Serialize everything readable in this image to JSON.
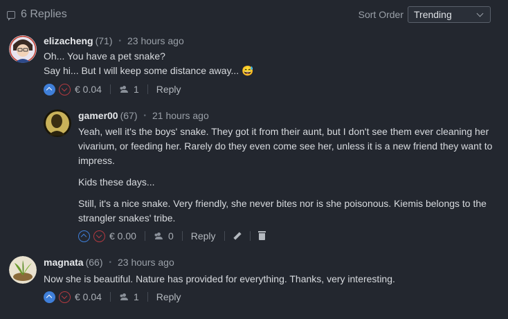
{
  "header": {
    "replies_label": "6 Replies",
    "sort_label": "Sort Order",
    "sort_value": "Trending"
  },
  "comments": [
    {
      "author": "elizacheng",
      "reputation": "(71)",
      "time": "23 hours ago",
      "lines": [
        "Oh... You have a pet snake?",
        "Say hi... But I will keep some distance away... 😅"
      ],
      "payout": "€ 0.04",
      "votes": "1",
      "reply": "Reply"
    },
    {
      "author": "gamer00",
      "reputation": "(67)",
      "time": "21 hours ago",
      "paragraphs": [
        "Yeah, well it's the boys' snake. They got it from their aunt, but I don't see them ever cleaning her vivarium, or feeding her. Rarely do they even come see her, unless it is a new friend they want to impress.",
        "Kids these days...",
        "Still, it's a nice snake. Very friendly, she never bites nor is she poisonous. Kiemis belongs to the strangler snakes' tribe."
      ],
      "payout": "€ 0.00",
      "votes": "0",
      "reply": "Reply"
    },
    {
      "author": "magnata",
      "reputation": "(66)",
      "time": "23 hours ago",
      "lines": [
        "Now she is beautiful. Nature has provided for everything. Thanks, very interesting."
      ],
      "payout": "€ 0.04",
      "votes": "1",
      "reply": "Reply"
    }
  ],
  "colors": {
    "background": "#23272f",
    "upvote": "#3f7fd9",
    "downvote": "#b23a40"
  }
}
